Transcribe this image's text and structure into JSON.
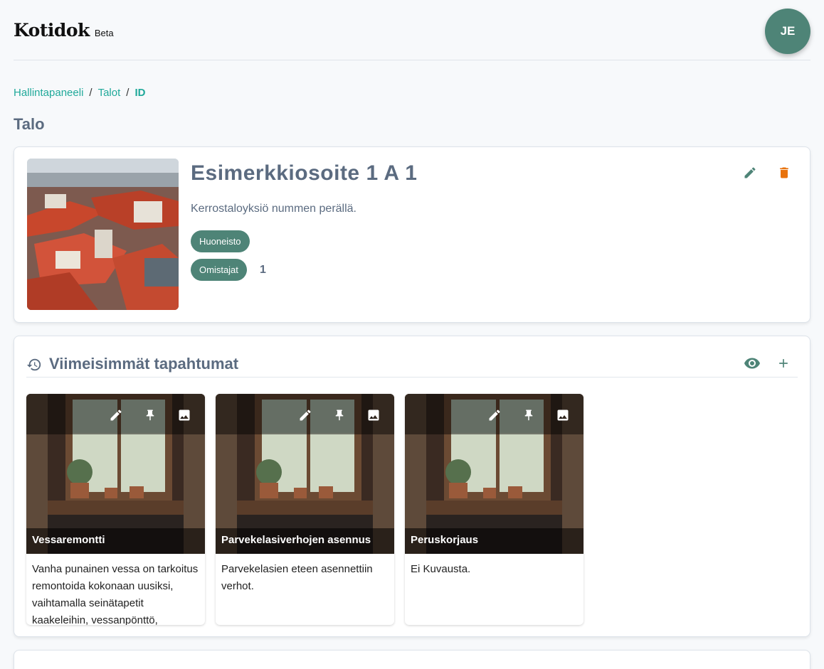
{
  "app": {
    "name": "Kotidok",
    "badge": "Beta"
  },
  "user": {
    "initials": "JE"
  },
  "breadcrumb": {
    "items": [
      "Hallintapaneeli",
      "Talot"
    ],
    "current": "ID"
  },
  "page": {
    "title": "Talo"
  },
  "house": {
    "address": "Esimerkkiosoite 1 A 1",
    "description": "Kerrostaloyksiö nummen perällä.",
    "type_label": "Huoneisto",
    "owners_label": "Omistajat",
    "owners_count": "1"
  },
  "events": {
    "title": "Viimeisimmät tapahtumat",
    "items": [
      {
        "title": "Vessaremontti",
        "description": "Vanha punainen vessa on tarkoitus remontoida kokonaan uusiksi, vaihtamalla seinätapetit kaakeleihin, vessanpönttö,"
      },
      {
        "title": "Parvekelasiverhojen asennus",
        "description": "Parvekelasien eteen asennettiin verhot."
      },
      {
        "title": "Peruskorjaus",
        "description": "Ei Kuvausta."
      }
    ]
  },
  "colors": {
    "accent": "#4e8477",
    "link": "#20a99a",
    "danger": "#e8720c"
  },
  "icons": {
    "edit": "pencil-icon",
    "delete": "trash-icon",
    "history": "history-icon",
    "view": "eye-icon",
    "add": "plus-icon",
    "pin": "pin-icon",
    "image": "image-icon"
  }
}
